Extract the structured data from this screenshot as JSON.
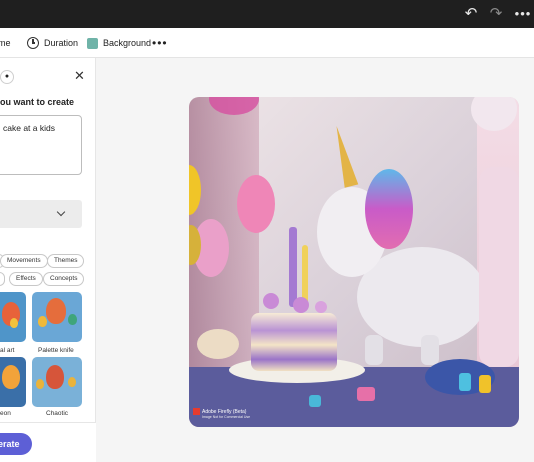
{
  "topbar": {
    "undo_icon": "undo-icon",
    "redo_icon": "redo-icon",
    "more_icon": "more-icon",
    "undo_glyph": "↶",
    "redo_glyph": "↷",
    "more_glyph": "•••"
  },
  "toolbar": {
    "theme_label": "me",
    "duration_label": "Duration",
    "background_label": "Background",
    "background_color": "#6fb3a8",
    "more_glyph": "•••"
  },
  "panel": {
    "heading": "ou want to create",
    "prompt_value": "cake at a kids",
    "close_glyph": "✕",
    "chips": [
      "Movements",
      "Themes",
      "Effects",
      "Concepts"
    ],
    "thumbs": [
      {
        "label": "al art"
      },
      {
        "label": "Palette knife"
      },
      {
        "label": "eon"
      },
      {
        "label": "Chaotic"
      }
    ],
    "generate_label": "erate"
  },
  "image": {
    "watermark_title": "Adobe Firefly (Beta)",
    "watermark_sub": "Image Not for Commercial Use"
  },
  "colors": {
    "accent": "#5d5fd6",
    "topbar": "#1f1f1f"
  }
}
